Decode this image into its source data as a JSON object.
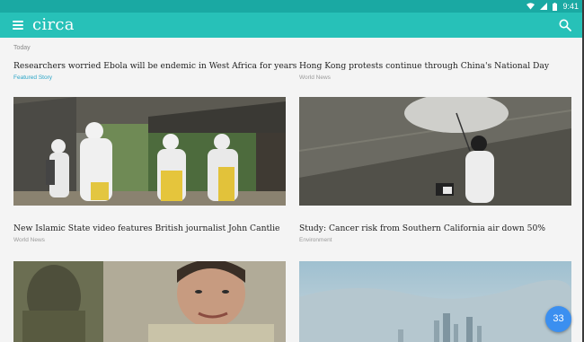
{
  "status_bar": {
    "time": "9:41"
  },
  "app_bar": {
    "title": "circa",
    "menu_icon": "menu-icon",
    "search_icon": "search-icon"
  },
  "feed": {
    "section_label": "Today",
    "stories": [
      {
        "title": "Researchers worried Ebola will be endemic in West Africa for years",
        "category": "Featured Story"
      },
      {
        "title": "Hong Kong protests continue through China's National Day",
        "category": "World News"
      },
      {
        "title": "New Islamic State video features British journalist John Cantlie",
        "category": "World News"
      },
      {
        "title": "Study: Cancer risk from Southern California air down 50%",
        "category": "Environment"
      }
    ]
  },
  "fab": {
    "count": "33"
  },
  "colors": {
    "accent": "#27c1b8",
    "status": "#1aa9a3",
    "featured": "#2aa5c7",
    "fab": "#3b8ff0"
  }
}
